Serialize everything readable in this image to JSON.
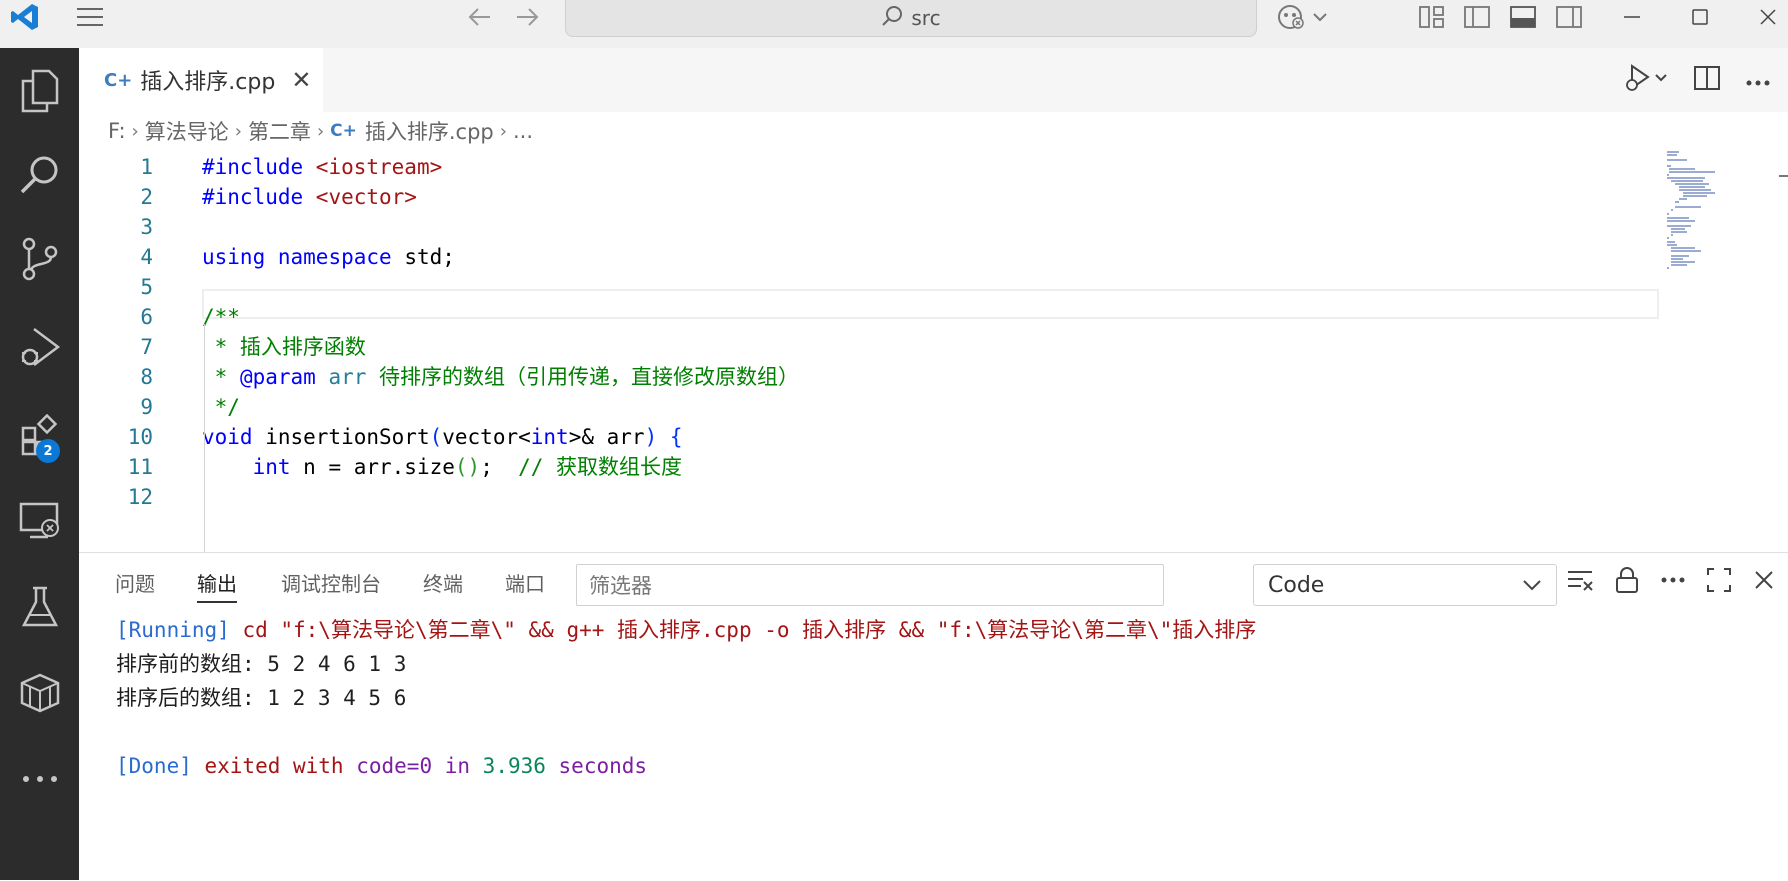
{
  "titlebar": {
    "search_text": "src"
  },
  "activity_bar": {
    "extensions_badge": "2"
  },
  "editor_tab": {
    "icon_glyph": "C+",
    "label": "插入排序.cpp"
  },
  "breadcrumb": {
    "drive": "F:",
    "folder1": "算法导论",
    "folder2": "第二章",
    "file": "插入排序.cpp",
    "more": "..."
  },
  "code_lines": [
    {
      "num": "1",
      "tokens": [
        {
          "t": "#include ",
          "c": "pp"
        },
        {
          "t": "<iostream>",
          "c": "str"
        }
      ]
    },
    {
      "num": "2",
      "tokens": [
        {
          "t": "#include ",
          "c": "pp"
        },
        {
          "t": "<vector>",
          "c": "str"
        }
      ]
    },
    {
      "num": "3",
      "tokens": []
    },
    {
      "num": "4",
      "tokens": [
        {
          "t": "using",
          "c": "kw"
        },
        {
          "t": " "
        },
        {
          "t": "namespace",
          "c": "kw"
        },
        {
          "t": " std;"
        }
      ]
    },
    {
      "num": "5",
      "tokens": []
    },
    {
      "num": "6",
      "tokens": [
        {
          "t": "/**",
          "c": "cm"
        }
      ]
    },
    {
      "num": "7",
      "tokens": [
        {
          "t": " * 插入排序函数",
          "c": "cm"
        }
      ]
    },
    {
      "num": "8",
      "tokens": [
        {
          "t": " * ",
          "c": "cm"
        },
        {
          "t": "@param",
          "c": "kw"
        },
        {
          "t": " ",
          "c": "cm"
        },
        {
          "t": "arr",
          "c": "ty"
        },
        {
          "t": " 待排序的数组（引用传递，直接修改原数组）",
          "c": "cm"
        }
      ]
    },
    {
      "num": "9",
      "tokens": [
        {
          "t": " */",
          "c": "cm"
        }
      ]
    },
    {
      "num": "10",
      "tokens": [
        {
          "t": "void",
          "c": "kw"
        },
        {
          "t": " insertionSort"
        },
        {
          "t": "(",
          "c": "br1"
        },
        {
          "t": "vector<"
        },
        {
          "t": "int",
          "c": "kw"
        },
        {
          "t": ">& arr"
        },
        {
          "t": ")",
          "c": "br1"
        },
        {
          "t": " "
        },
        {
          "t": "{",
          "c": "br1"
        }
      ]
    },
    {
      "num": "11",
      "tokens": [
        {
          "t": "    "
        },
        {
          "t": "int",
          "c": "kw"
        },
        {
          "t": " n = arr.size"
        },
        {
          "t": "()",
          "c": "br2"
        },
        {
          "t": ";  "
        },
        {
          "t": "// 获取数组长度",
          "c": "cm"
        }
      ]
    },
    {
      "num": "12",
      "tokens": []
    }
  ],
  "panel": {
    "tabs": [
      "问题",
      "输出",
      "调试控制台",
      "终端",
      "端口"
    ],
    "active_tab": "输出",
    "filter_placeholder": "筛选器",
    "channel": "Code"
  },
  "output": {
    "running_tag": "[Running]",
    "running_cmd": " cd \"f:\\算法导论\\第二章\\\" && g++ 插入排序.cpp -o 插入排序 && \"f:\\算法导论\\第二章\\\"插入排序",
    "before_line": "排序前的数组: 5 2 4 6 1 3",
    "after_line": "排序后的数组: 1 2 3 4 5 6",
    "done_tag": "[Done]",
    "done_exited": " exited with ",
    "done_code": "code=0",
    "done_in": " in ",
    "done_seconds_value": "3.936",
    "done_seconds_word": " seconds"
  }
}
